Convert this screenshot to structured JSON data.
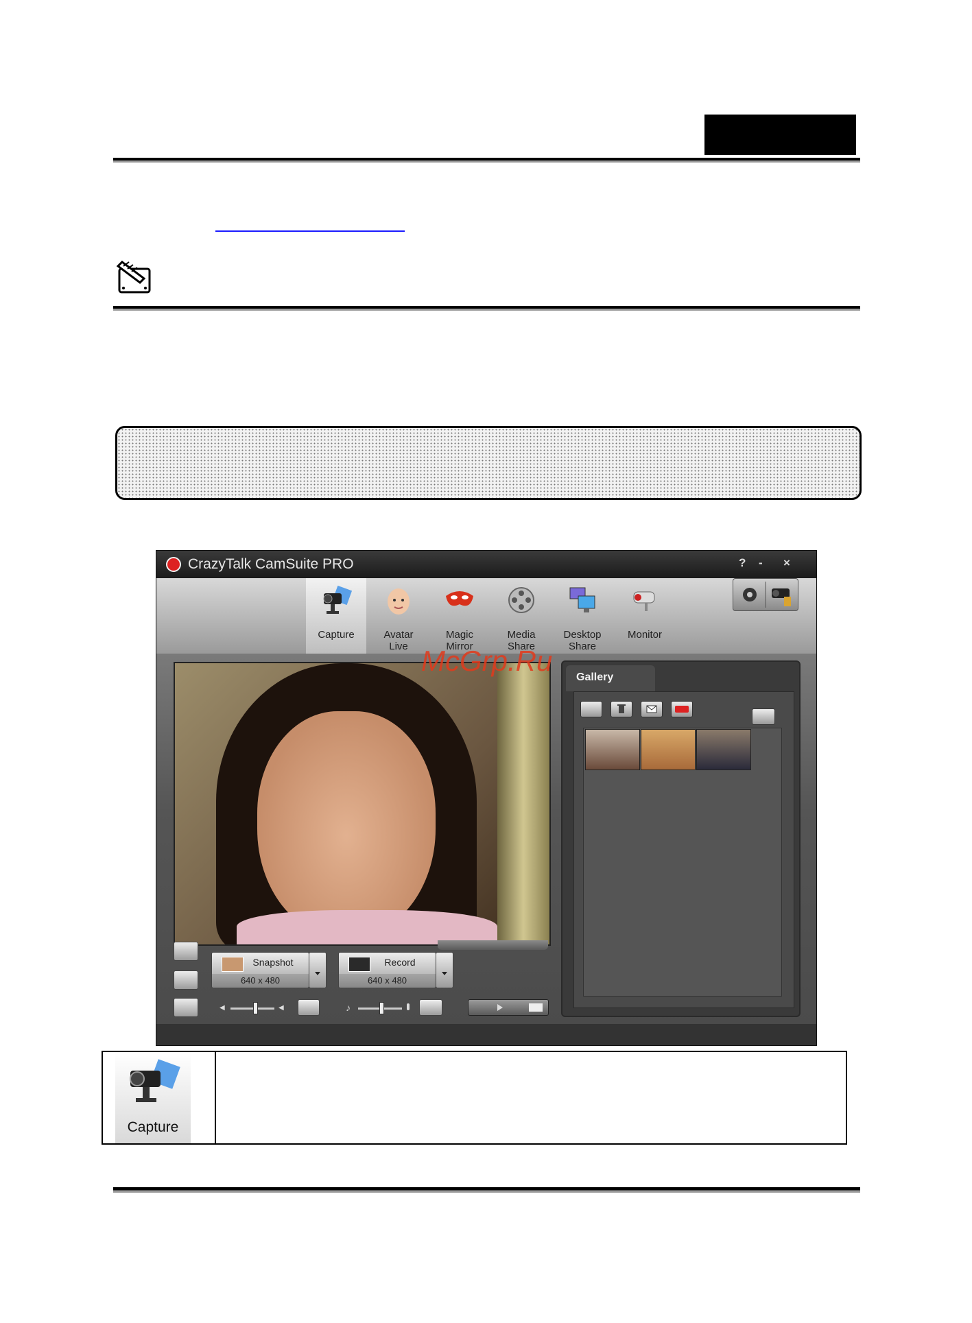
{
  "app": {
    "title": "CrazyTalk CamSuite PRO",
    "help": "?",
    "minimize": "-",
    "close": "×",
    "tools": [
      {
        "label": "Capture",
        "icon": "camera-icon"
      },
      {
        "label": "Avatar\nLive",
        "icon": "baby-face-icon"
      },
      {
        "label": "Magic\nMirror",
        "icon": "mask-icon"
      },
      {
        "label": "Media\nShare",
        "icon": "film-reel-icon"
      },
      {
        "label": "Desktop\nShare",
        "icon": "monitors-icon"
      },
      {
        "label": "Monitor",
        "icon": "security-camera-icon"
      }
    ],
    "snapshot": {
      "label": "Snapshot",
      "resolution": "640 x 480"
    },
    "record": {
      "label": "Record",
      "resolution": "640 x 480"
    },
    "gallery": {
      "title": "Gallery"
    }
  },
  "watermark": "McGrp.Ru",
  "icon_table": {
    "label": "Capture",
    "icon": "camera-icon"
  }
}
